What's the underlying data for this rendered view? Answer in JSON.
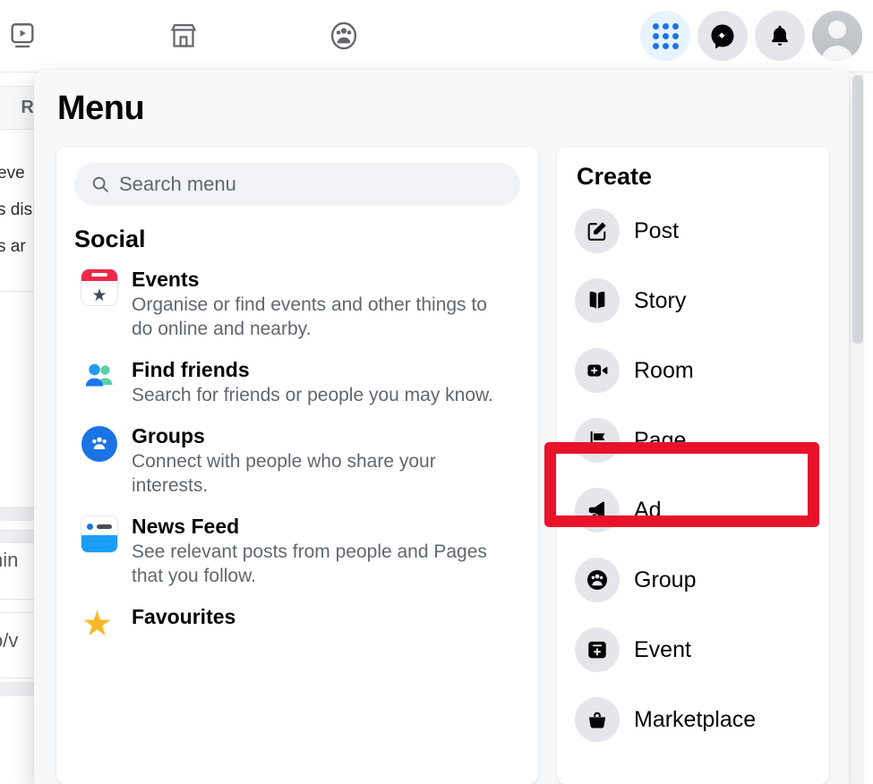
{
  "topbar": {
    "nav_icons": [
      {
        "name": "watch-icon",
        "label": "Watch"
      },
      {
        "name": "marketplace-icon",
        "label": "Marketplace"
      },
      {
        "name": "groups-icon",
        "label": "Groups"
      }
    ],
    "right_icons": [
      {
        "name": "menu-grid-icon",
        "label": "Menu"
      },
      {
        "name": "messenger-icon",
        "label": "Messenger"
      },
      {
        "name": "notifications-bell-icon",
        "label": "Notifications"
      },
      {
        "name": "profile-avatar",
        "label": "Account"
      }
    ]
  },
  "background": {
    "card_header": "Re",
    "lines": [
      "eve",
      "s dis",
      "s ar"
    ],
    "strips": [
      "nin",
      "o/v"
    ]
  },
  "menu": {
    "title": "Menu",
    "search": {
      "placeholder": "Search menu",
      "value": "",
      "icon": "search-icon"
    },
    "sections": [
      {
        "title": "Social",
        "items": [
          {
            "icon": "events-calendar-icon",
            "name": "Events",
            "desc": "Organise or find events and other things to do online and nearby."
          },
          {
            "icon": "find-friends-icon",
            "name": "Find friends",
            "desc": "Search for friends or people you may know."
          },
          {
            "icon": "groups-icon",
            "name": "Groups",
            "desc": "Connect with people who share your interests."
          },
          {
            "icon": "news-feed-icon",
            "name": "News Feed",
            "desc": "See relevant posts from people and Pages that you follow."
          },
          {
            "icon": "favourites-star-icon",
            "name": "Favourites",
            "desc": ""
          }
        ]
      }
    ],
    "create": {
      "title": "Create",
      "items": [
        {
          "icon": "post-compose-icon",
          "label": "Post"
        },
        {
          "icon": "story-book-icon",
          "label": "Story"
        },
        {
          "icon": "room-video-icon",
          "label": "Room"
        },
        {
          "icon": "page-flag-icon",
          "label": "Page",
          "highlighted": true
        },
        {
          "icon": "ad-megaphone-icon",
          "label": "Ad"
        },
        {
          "icon": "group-people-icon",
          "label": "Group"
        },
        {
          "icon": "event-calendar-plus-icon",
          "label": "Event"
        },
        {
          "icon": "marketplace-basket-icon",
          "label": "Marketplace"
        }
      ]
    }
  },
  "colors": {
    "accent_blue": "#1b74e4",
    "highlight_red": "#e8132b",
    "panel_bg": "#f7f8fa",
    "card_bg": "#ffffff",
    "text_primary": "#050505",
    "text_secondary": "#606770"
  }
}
